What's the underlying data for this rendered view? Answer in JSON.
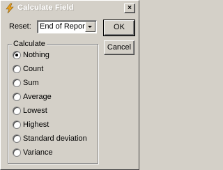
{
  "window": {
    "title": "Calculate Field",
    "close_label": "×",
    "icon": "lightning-icon"
  },
  "reset": {
    "label": "Reset:",
    "selected": "End of Report",
    "arrow_icon": "chevron-down-icon"
  },
  "buttons": {
    "ok": "OK",
    "cancel": "Cancel"
  },
  "calculate": {
    "legend": "Calculate",
    "selected": "Nothing",
    "options": [
      "Nothing",
      "Count",
      "Sum",
      "Average",
      "Lowest",
      "Highest",
      "Standard deviation",
      "Variance"
    ]
  },
  "colors": {
    "face": "#d4d0c8",
    "title_text": "#ffffff",
    "icon": "#e8a020"
  }
}
